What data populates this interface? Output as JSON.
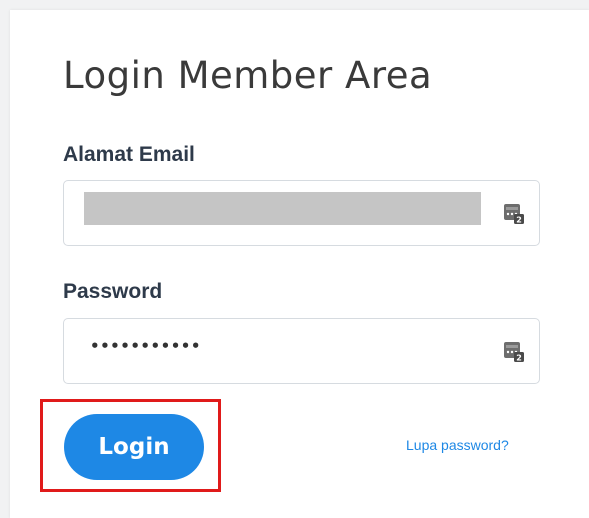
{
  "form": {
    "title": "Login Member Area",
    "email_label": "Alamat Email",
    "email_value": "",
    "password_label": "Password",
    "password_value": "•••••••••••",
    "login_label": "Login",
    "forgot_label": "Lupa password?"
  },
  "icons": {
    "email_field_icon": "password-manager-icon",
    "password_field_icon": "password-manager-icon"
  },
  "colors": {
    "accent": "#1e88e5",
    "highlight": "#e01a1a",
    "redaction": "#c5c5c5"
  }
}
